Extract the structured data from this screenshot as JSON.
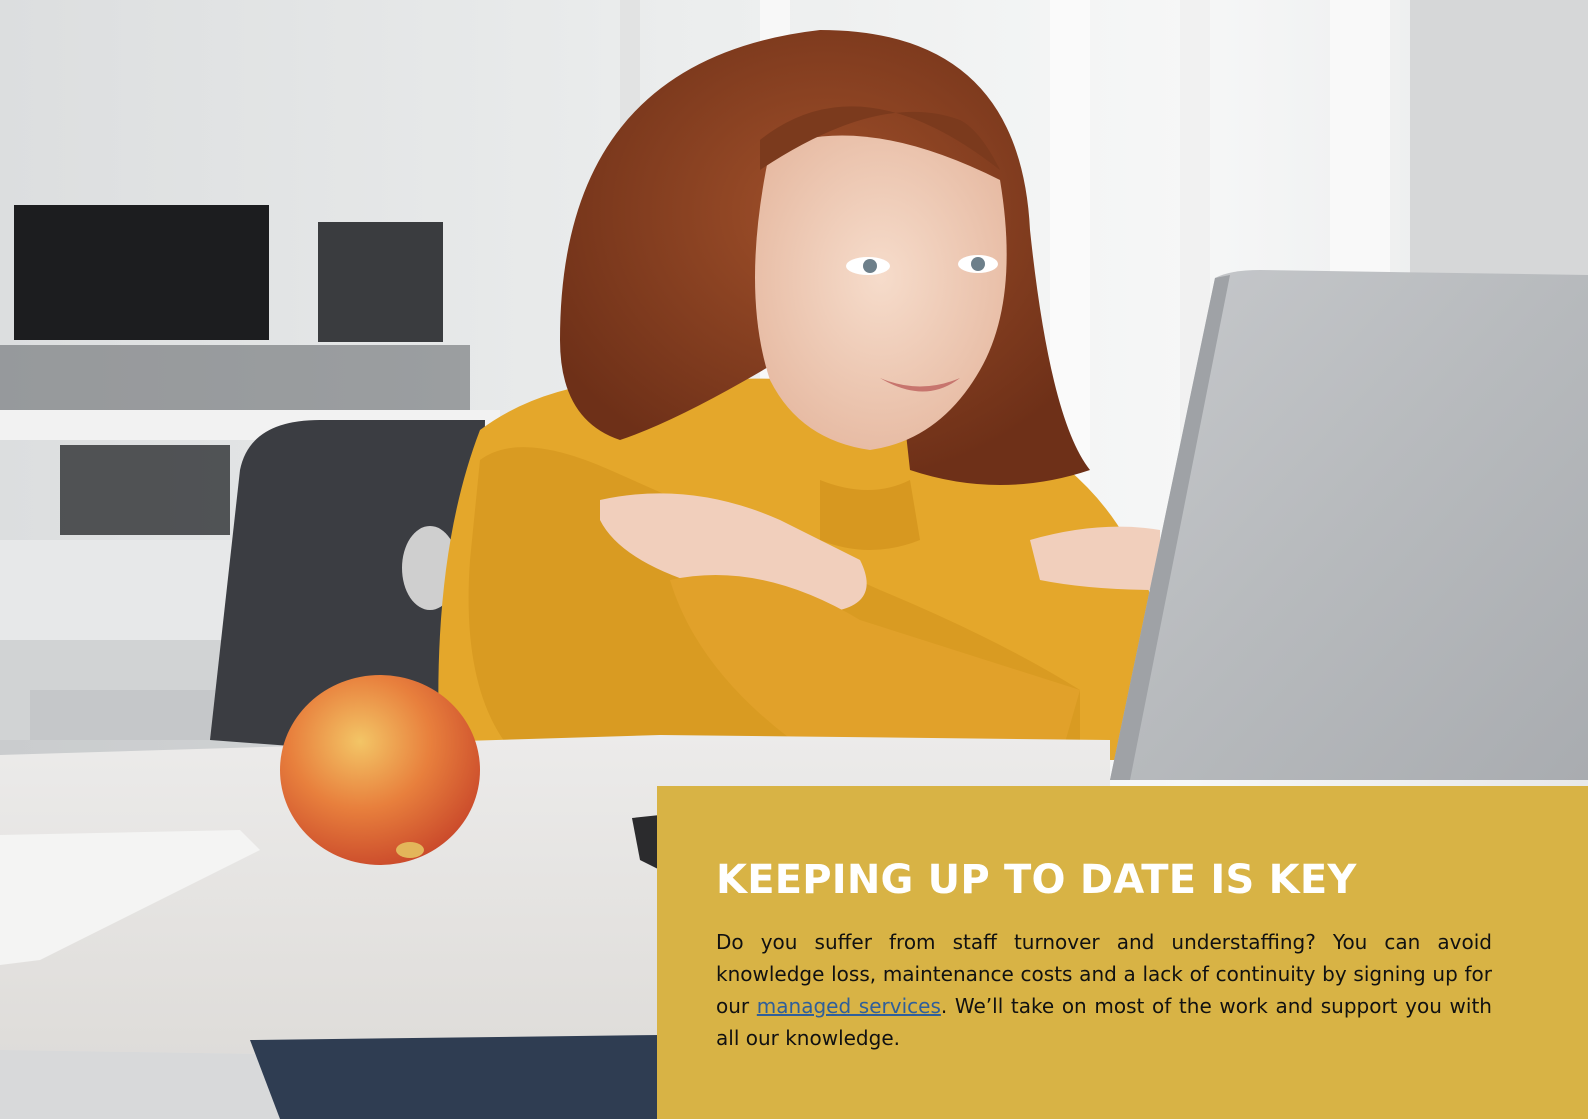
{
  "article": {
    "title": "KEEPING UP TO DATE IS KEY",
    "body_before_link": "Do you suffer from staff turnover and understaffing? You can avoid knowledge loss, maintenance costs and a lack of continuity by signing up for our ",
    "link_text": "managed services",
    "body_after_link": ". We’ll take on most of the work and support you with all our knowl­edge."
  },
  "colors": {
    "panel_background": "#d8b345",
    "title": "#ffffff",
    "body_text": "#111111",
    "link": "#2f5f9a",
    "sweater": "#e4a72b"
  },
  "image": {
    "subject": "woman-at-laptop-photo"
  }
}
